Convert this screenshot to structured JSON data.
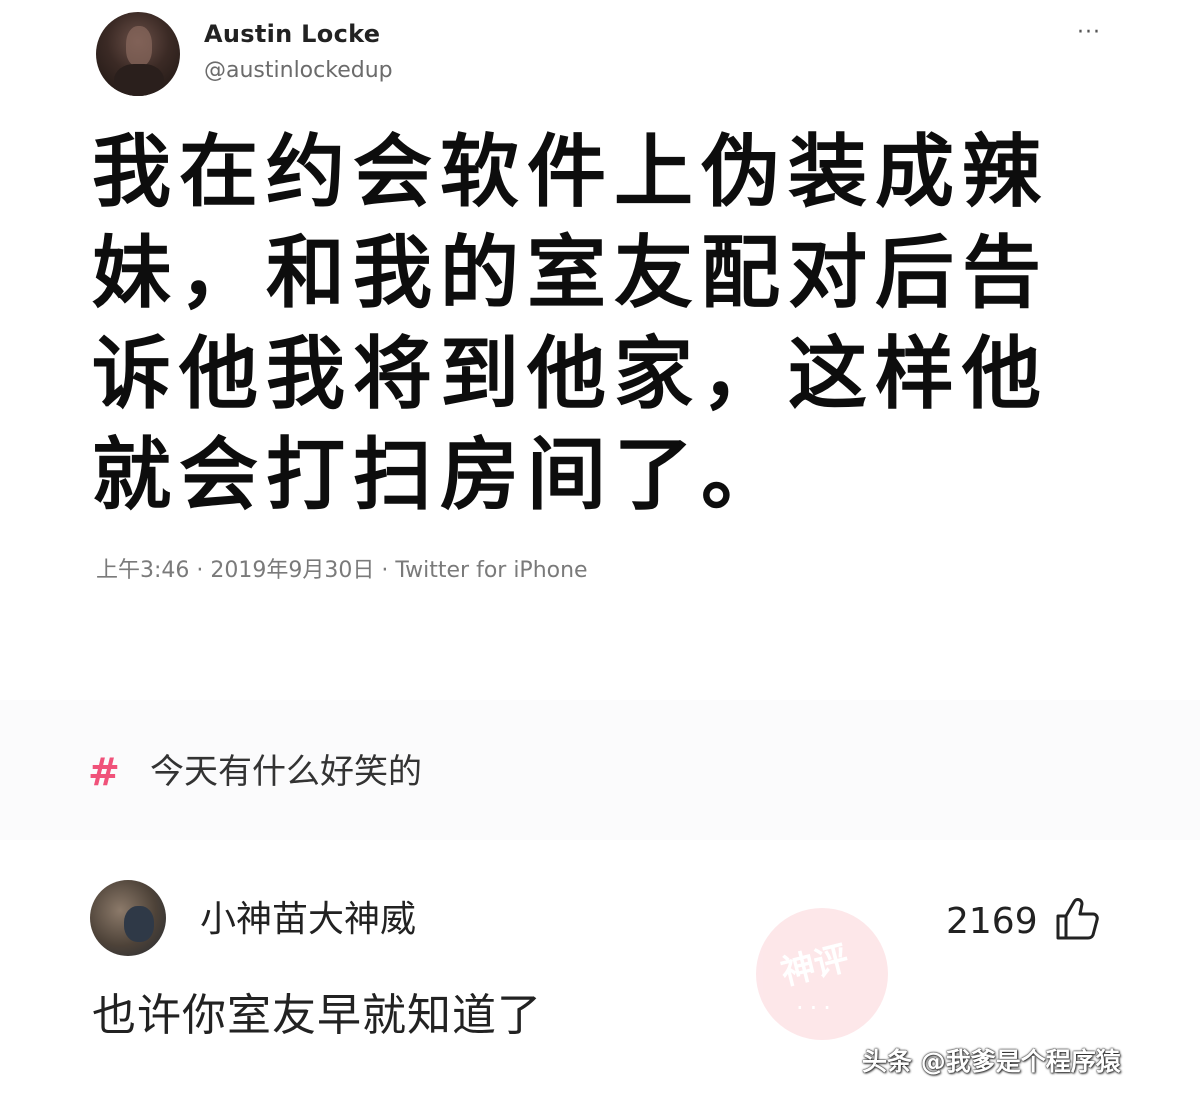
{
  "tweet": {
    "user_name": "Austin Locke",
    "handle": "@austinlockedup",
    "more_glyph": "···",
    "text": "我在约会软件上伪装成辣妹，和我的室友配对后告诉他我将到他家，这样他就会打扫房间了。",
    "meta": "上午3:46 · 2019年9月30日 · Twitter for iPhone"
  },
  "topic": {
    "icon": "#",
    "label": "今天有什么好笑的",
    "icon_color": "#f0527a"
  },
  "comment": {
    "user_name": "小神苗大神威",
    "likes": "2169",
    "like_icon": "thumbs-up-icon",
    "text": "也许你室友早就知道了"
  },
  "stamp": {
    "label": "神评",
    "dots": "···"
  },
  "watermark": "头条 @我爹是个程序猿"
}
